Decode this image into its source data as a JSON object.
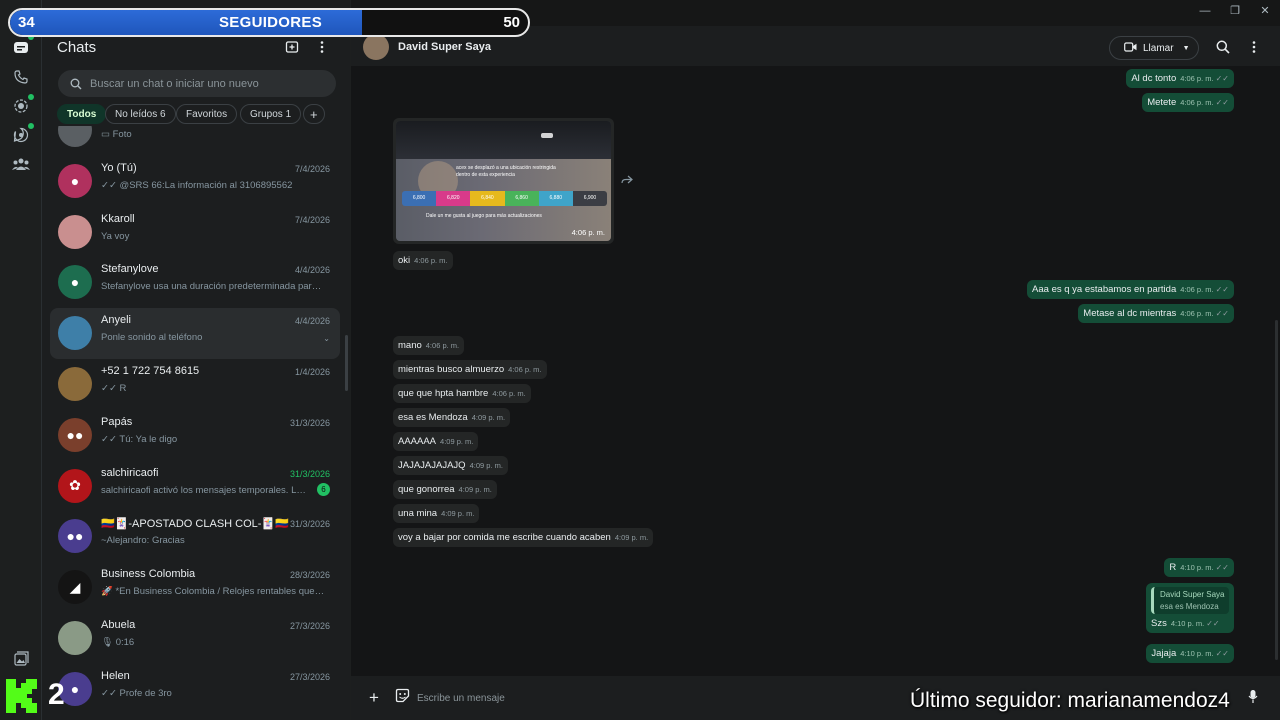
{
  "overlay": {
    "followers_current": "34",
    "followers_label": "SEGUIDORES",
    "followers_goal": "50",
    "progress_fraction": 0.68,
    "kick_number": "2",
    "last_follower": "Último seguidor: marianamendoz4"
  },
  "window_controls": {
    "minimize": "—",
    "restore": "❐",
    "close": "✕"
  },
  "rail": {
    "icons": [
      "chats-icon",
      "calls-icon",
      "status-icon",
      "channels-icon",
      "communities-icon",
      "media-icon"
    ]
  },
  "list": {
    "title": "Chats",
    "search_placeholder": "Buscar un chat o iniciar uno nuevo",
    "chips": [
      {
        "label": "Todos"
      },
      {
        "label": "No leídos 6"
      },
      {
        "label": "Favoritos"
      },
      {
        "label": "Grupos 1"
      },
      {
        "label": "+"
      }
    ],
    "chats": [
      {
        "name": "",
        "time": "",
        "preview": "▭ Foto",
        "avatar_color": "#5a5f63",
        "avatar_glyph": ""
      },
      {
        "name": "Yo (Tú)",
        "time": "7/4/2026",
        "preview": "✓✓ @SRS 66:La información al 3106895562",
        "avatar_color": "#b0315e",
        "avatar_glyph": "●"
      },
      {
        "name": "Kkaroll",
        "time": "7/4/2026",
        "preview": "Ya voy",
        "avatar_color": "#c98f8f",
        "avatar_glyph": ""
      },
      {
        "name": "Stefanylove",
        "time": "4/4/2026",
        "preview": "Stefanylove usa una duración predeterminada para los mensajes temporales",
        "avatar_color": "#1d6d4f",
        "avatar_glyph": "●"
      },
      {
        "name": "Anyeli",
        "time": "4/4/2026",
        "preview": "Ponle sonido al teléfono",
        "avatar_color": "#3e7fa8",
        "avatar_glyph": ""
      },
      {
        "name": "+52 1 722 754 8615",
        "time": "1/4/2026",
        "preview": "✓✓ R",
        "avatar_color": "#8a6a3a",
        "avatar_glyph": ""
      },
      {
        "name": "Papás",
        "time": "31/3/2026",
        "preview": "✓✓ Tú: Ya le digo",
        "avatar_color": "#7a3f2c",
        "avatar_glyph": "●●"
      },
      {
        "name": "salchiricaofi",
        "time": "31/3/2026",
        "preview": "salchiricaofi activó los mensajes temporales. Los nuevos mensajes",
        "avatar_color": "#b2151a",
        "avatar_glyph": "✿",
        "badge": "6"
      },
      {
        "name": "🇨🇴🃏-APOSTADO CLASH COL-🃏🇨🇴",
        "time": "31/3/2026",
        "preview": "~Alejandro: Gracias",
        "avatar_color": "#4a3d8f",
        "avatar_glyph": "●●"
      },
      {
        "name": "Business Colombia",
        "time": "28/3/2026",
        "preview": "🚀 *En Business Colombia / Relojes rentables queremos",
        "avatar_color": "#141414",
        "avatar_glyph": "◢"
      },
      {
        "name": "Abuela",
        "time": "27/3/2026",
        "preview": "🎙 0:16",
        "avatar_color": "#8a9a86",
        "avatar_glyph": ""
      },
      {
        "name": "Helen",
        "time": "27/3/2026",
        "preview": "✓✓ Profe de 3ro",
        "avatar_color": "#4a3d8f",
        "avatar_glyph": "●"
      }
    ]
  },
  "chat": {
    "contact_name": "David Super Saya",
    "call_label": "Llamar",
    "image_time": "4:06 p. m.",
    "image_text": "acex se desplazó a una ubicación restringida dentro de esta experiencia",
    "image_numbers": [
      "6,800",
      "6,820",
      "6,840",
      "6,860",
      "6,880",
      "6,900"
    ],
    "image_caption": "Dale un me gusta al juego para más actualizaciones",
    "messages": [
      {
        "dir": "out",
        "text": "Al dc tonto",
        "time": "4:06 p. m."
      },
      {
        "dir": "out",
        "text": "Metete",
        "time": "4:06 p. m."
      },
      {
        "dir": "in",
        "text": "oki",
        "time": "4:06 p. m."
      },
      {
        "dir": "out",
        "text": "Aaa es q ya estabamos en partida",
        "time": "4:06 p. m."
      },
      {
        "dir": "out",
        "text": "Metase al dc mientras",
        "time": "4:06 p. m."
      },
      {
        "dir": "in",
        "text": "mano",
        "time": "4:06 p. m."
      },
      {
        "dir": "in",
        "text": "mientras busco almuerzo",
        "time": "4:06 p. m."
      },
      {
        "dir": "in",
        "text": "que que hpta hambre",
        "time": "4:06 p. m."
      },
      {
        "dir": "in",
        "text": "esa es Mendoza",
        "time": "4:09 p. m."
      },
      {
        "dir": "in",
        "text": "AAAAAA",
        "time": "4:09 p. m."
      },
      {
        "dir": "in",
        "text": "JAJAJAJAJAJQ",
        "time": "4:09 p. m."
      },
      {
        "dir": "in",
        "text": "que gonorrea",
        "time": "4:09 p. m."
      },
      {
        "dir": "in",
        "text": "una mina",
        "time": "4:09 p. m."
      },
      {
        "dir": "in",
        "text": "voy a bajar por comida me escribe cuando acaben",
        "time": "4:09 p. m."
      },
      {
        "dir": "out",
        "text": "R",
        "time": "4:10 p. m."
      },
      {
        "dir": "out",
        "text": "Szs",
        "time": "4:10 p. m.",
        "quote_name": "David Super Saya",
        "quote_text": "esa es Mendoza"
      },
      {
        "dir": "out",
        "text": "Jajaja",
        "time": "4:10 p. m."
      }
    ],
    "compose_placeholder": "Escribe un mensaje"
  }
}
